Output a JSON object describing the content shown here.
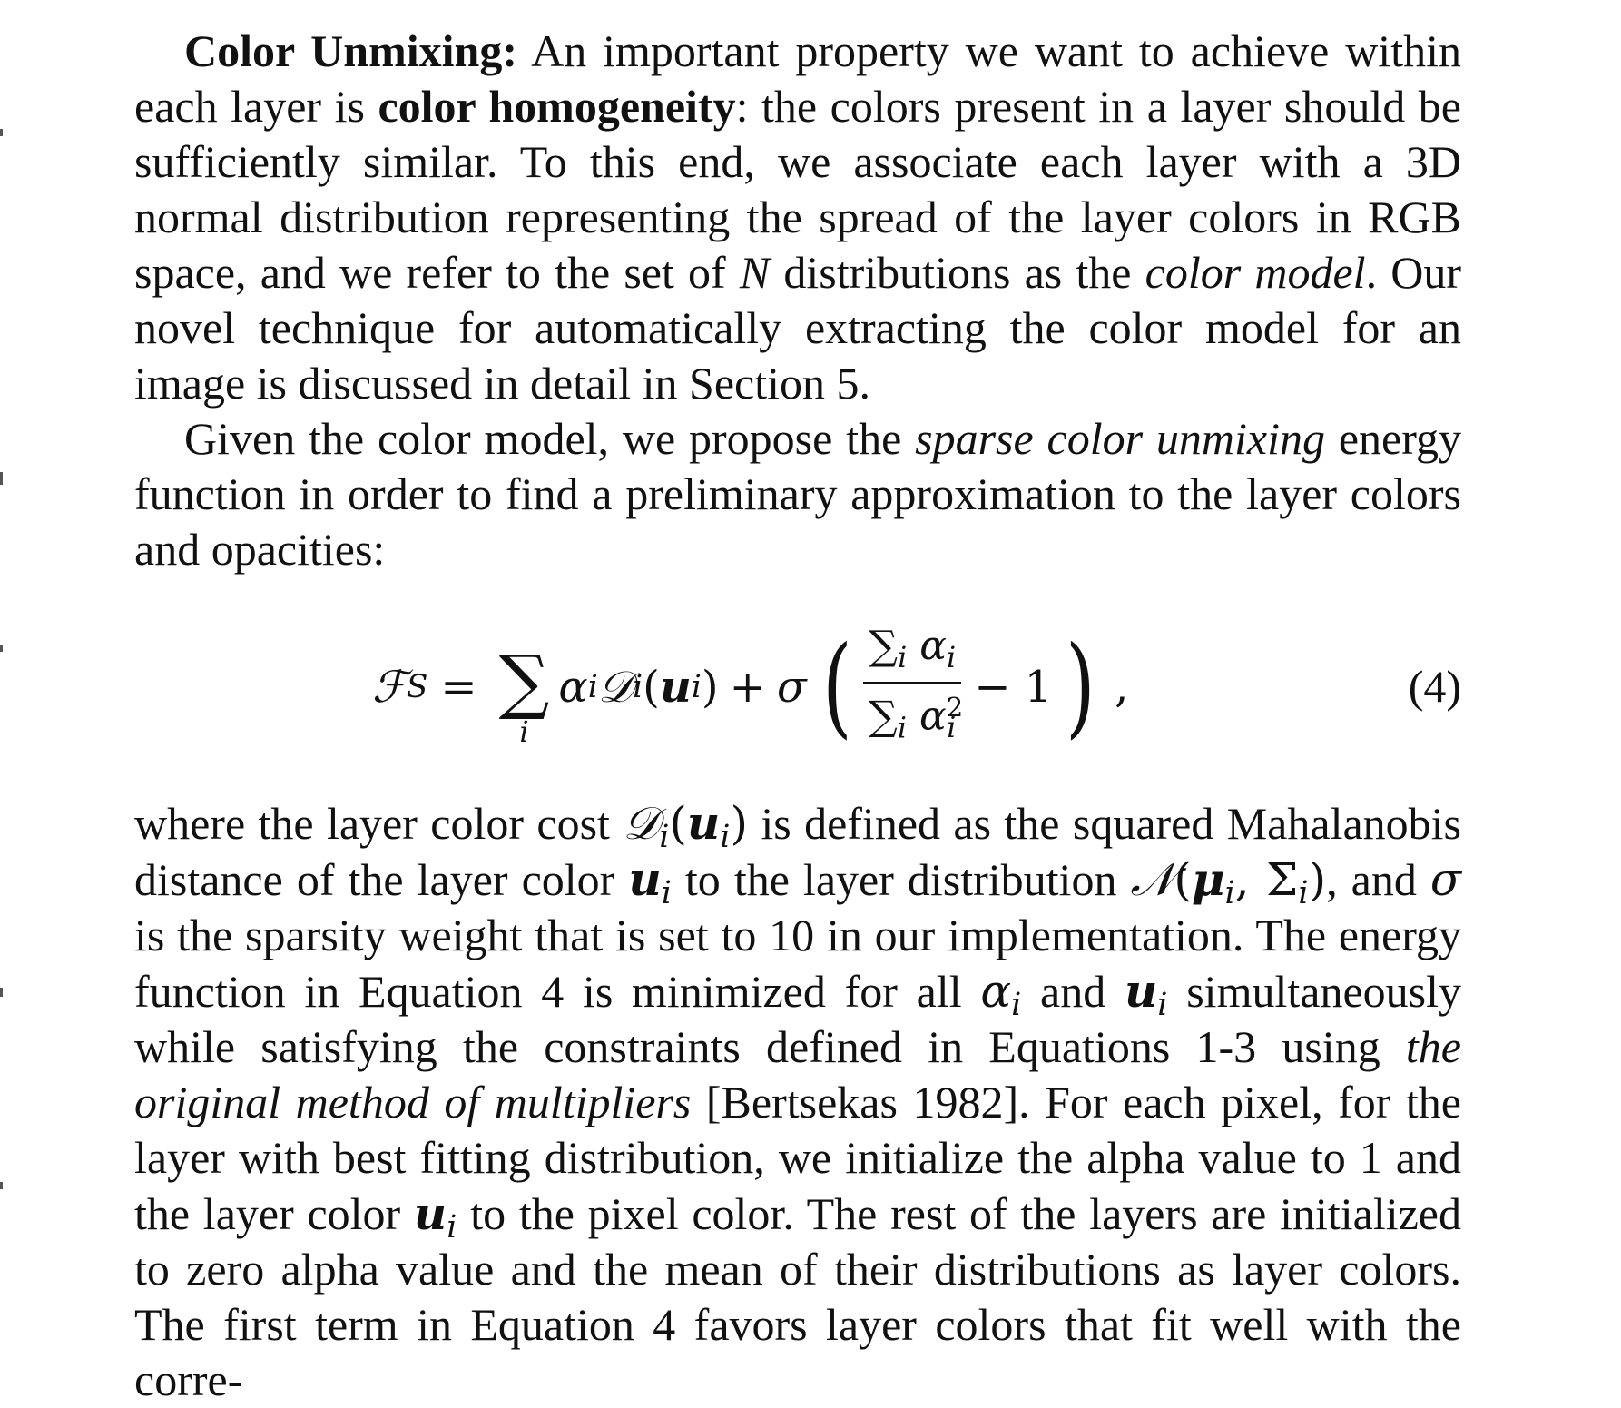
{
  "paragraph1": {
    "run_head": "Color Unmixing:",
    "text_a": " An important property we want to achieve within each layer is ",
    "bold_term": "color homogeneity",
    "text_b": ": the colors present in a layer should be sufficiently similar. To this end, we associate each layer with a 3D normal distribution representing the spread of the layer colors in RGB space, and we refer to the set of ",
    "var_N": "N",
    "text_c": " distributions as the ",
    "ital_term": "color model",
    "text_d": ". Our novel technique for automatically extracting the color model for an image is discussed in detail in Section 5."
  },
  "paragraph2": {
    "text_a": "Given the color model, we propose the ",
    "ital_term": "sparse color unmixing",
    "text_b": " energy function in order to find a preliminary approximation to the layer colors and opacities:"
  },
  "equation": {
    "lhs": "ℱ",
    "lhs_sub": "S",
    "equals": "=",
    "sum_symbol": "∑",
    "sum_index": "i",
    "alpha": "α",
    "idx": "i",
    "D": "𝒟",
    "u": "u",
    "plus": "+",
    "sigma": "σ",
    "minus_one": "− 1",
    "comma": ",",
    "number": "(4)",
    "squared": "2"
  },
  "paragraph3": {
    "text_a": "where the layer color cost ",
    "text_b": " is defined as the squared Mahalanobis distance of the layer color ",
    "text_c": " to the layer distribution ",
    "text_d": ", and ",
    "text_e": " is the sparsity weight that is set to 10 in our implementation. The energy function in Equation 4 is minimized for all ",
    "text_f": " and ",
    "text_g": " simultaneously while satisfying the constraints defined in Equations 1-3 using ",
    "ital_term": "the original method of multipliers",
    "text_h": " [Bertsekas 1982]. For each pixel, for the layer with best fitting distribution, we initialize the alpha value to 1 and the layer color ",
    "text_i": " to the pixel color. The rest of the layers are initialized to zero alpha value and the mean of their distributions as layer colors. The first term in Equation 4 favors layer colors that fit well with the corre-",
    "math_N": "𝒩",
    "math_mu": "μ",
    "math_Sigma": "Σ",
    "math_sigma": "σ",
    "math_alpha": "α",
    "math_u": "u",
    "math_D": "𝒟",
    "math_i": "i"
  }
}
